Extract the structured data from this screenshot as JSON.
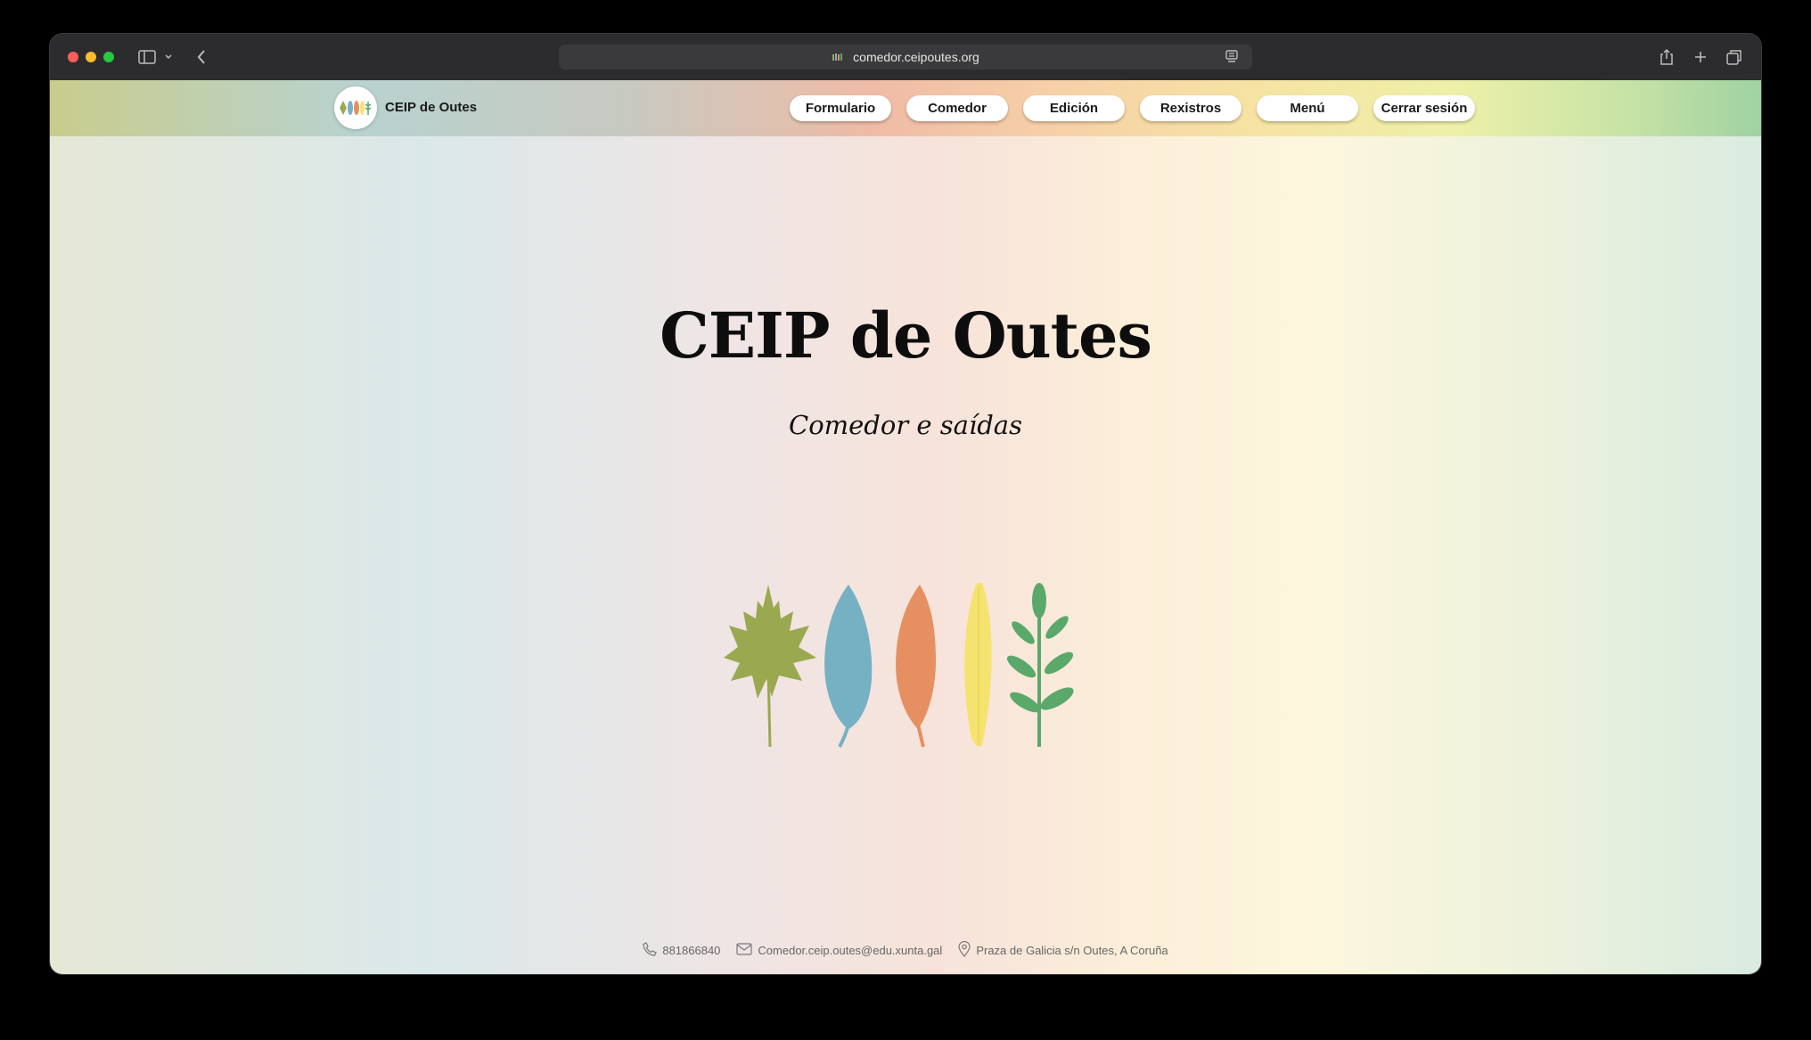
{
  "browser": {
    "url": "comedor.ceipoutes.org",
    "icons": [
      "sidebar-icon",
      "chevron-down-icon",
      "back-icon",
      "reader-icon",
      "share-icon",
      "new-tab-icon",
      "tabs-overview-icon"
    ]
  },
  "header": {
    "brand": "CEIP de Outes",
    "nav": [
      {
        "label": "Formulario"
      },
      {
        "label": "Comedor"
      },
      {
        "label": "Edición"
      },
      {
        "label": "Rexistros"
      },
      {
        "label": "Menú"
      },
      {
        "label": "Cerrar sesión"
      }
    ]
  },
  "hero": {
    "title": "CEIP de Outes",
    "subtitle": "Comedor e saídas",
    "leaf_colors": [
      "#9aa84f",
      "#76b1c3",
      "#e68f61",
      "#f5e36f",
      "#5aa96a"
    ]
  },
  "footer": {
    "phone": "881866840",
    "email": "Comedor.ceip.outes@edu.xunta.gal",
    "address": "Praza de Galicia s/n Outes, A Coruña"
  }
}
